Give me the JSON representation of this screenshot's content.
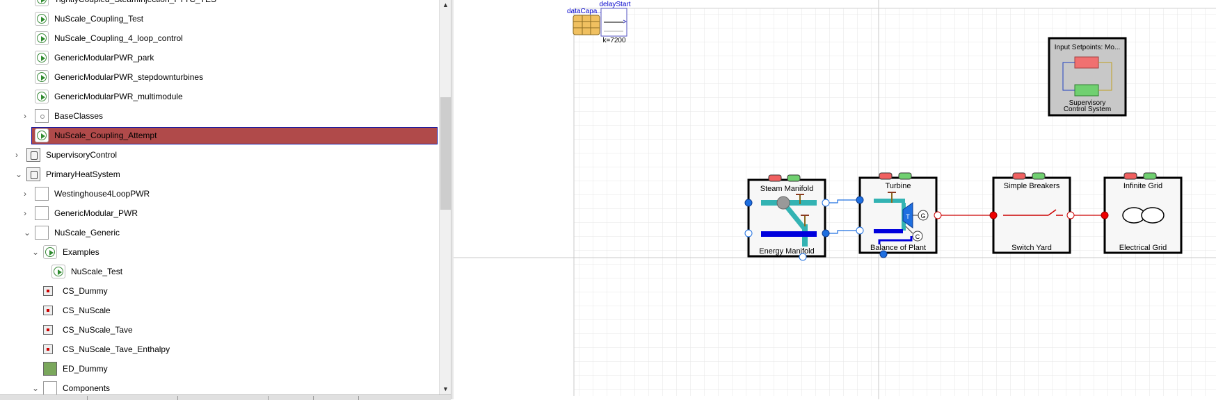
{
  "tree": {
    "items": [
      {
        "label": "TightlyCoupled_SteamInjection_FTTC_TES",
        "icon": "play-icon"
      },
      {
        "label": "NuScale_Coupling_Test",
        "icon": "play-icon"
      },
      {
        "label": "NuScale_Coupling_4_loop_control",
        "icon": "play-icon"
      },
      {
        "label": "GenericModularPWR_park",
        "icon": "play-icon"
      },
      {
        "label": "GenericModularPWR_stepdownturbines",
        "icon": "play-icon"
      },
      {
        "label": "GenericModularPWR_multimodule",
        "icon": "play-icon"
      },
      {
        "label": "BaseClasses",
        "icon": "package-icon"
      },
      {
        "label": "NuScale_Coupling_Attempt",
        "icon": "play-icon",
        "selected": true
      },
      {
        "label": "SupervisoryControl",
        "icon": "gear-icon"
      },
      {
        "label": "PrimaryHeatSystem",
        "icon": "gear-icon"
      },
      {
        "label": "Westinghouse4LoopPWR",
        "icon": "package-icon"
      },
      {
        "label": "GenericModular_PWR",
        "icon": "package-icon"
      },
      {
        "label": "NuScale_Generic",
        "icon": "package-icon"
      },
      {
        "label": "Examples",
        "icon": "play-icon"
      },
      {
        "label": "NuScale_Test",
        "icon": "play-icon"
      },
      {
        "label": "CS_Dummy",
        "icon": "block-icon"
      },
      {
        "label": "CS_NuScale",
        "icon": "block-icon"
      },
      {
        "label": "CS_NuScale_Tave",
        "icon": "block-icon"
      },
      {
        "label": "CS_NuScale_Tave_Enthalpy",
        "icon": "block-icon"
      },
      {
        "label": "ED_Dummy",
        "icon": "grid-icon"
      },
      {
        "label": "Components",
        "icon": "package-icon"
      }
    ]
  },
  "diagram": {
    "dataCapacity_label": "dataCapa...",
    "delayStart_label": "delayStart",
    "delayStart_param": "k=7200",
    "supervisory_title": "Input Setpoints: Mo...",
    "supervisory_name_line1": "Supervisory",
    "supervisory_name_line2": "Control System",
    "steam_manifold_label": "Steam Manifold",
    "energy_manifold_label": "Energy Manifold",
    "turbine_label": "Turbine",
    "bop_label": "Balance of Plant",
    "generator_label": "G",
    "condenser_label": "C",
    "turbine_symbol": "T",
    "breakers_top_label": "Simple Breakers",
    "breakers_bottom_label": "Switch Yard",
    "grid_top_label": "Infinite Grid",
    "grid_bottom_label": "Electrical Grid"
  },
  "colors": {
    "selection_bg": "#b04a4a",
    "selection_border": "#1a1aa0",
    "port_blue": "#1e6fe0",
    "wire_red": "#cc0000",
    "pipe_teal": "#33b3b3",
    "pipe_blue": "#0000dd",
    "sensor_red": "#f06060",
    "sensor_green": "#70d070"
  }
}
